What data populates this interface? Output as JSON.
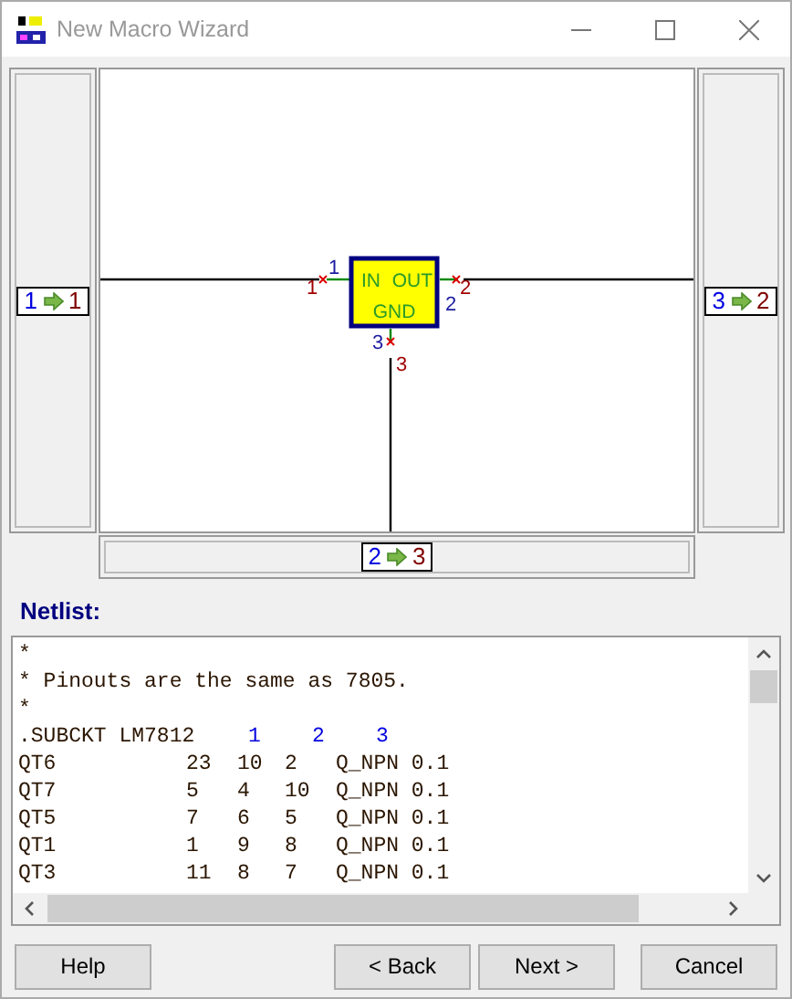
{
  "window": {
    "title": "New Macro Wizard"
  },
  "diagram": {
    "component": {
      "labels": [
        "IN",
        "OUT",
        "GND"
      ]
    },
    "pins": [
      {
        "text": "1",
        "kind": "innumber"
      },
      {
        "text": "1",
        "kind": "innet"
      },
      {
        "text": "2",
        "kind": "outnet"
      },
      {
        "text": "2",
        "kind": "outnumber"
      },
      {
        "text": "3",
        "kind": "gndnumber"
      },
      {
        "text": "3",
        "kind": "gndnet"
      }
    ],
    "ports": [
      {
        "pin": "1",
        "node": "1"
      },
      {
        "pin": "3",
        "node": "2"
      },
      {
        "pin": "2",
        "node": "3"
      }
    ]
  },
  "netlist": {
    "label": "Netlist:",
    "lines": [
      {
        "kind": "text",
        "text": "*"
      },
      {
        "kind": "text",
        "text": "* Pinouts are the same as 7805."
      },
      {
        "kind": "text",
        "text": "*"
      },
      {
        "kind": "subckt",
        "text": ".SUBCKT LM7812",
        "nodes": [
          "1",
          "2",
          "3"
        ]
      },
      {
        "kind": "element",
        "cells": [
          "QT6",
          "23",
          "10",
          "2",
          "Q_NPN 0.1"
        ]
      },
      {
        "kind": "element",
        "cells": [
          "QT7",
          "5",
          "4",
          "10",
          "Q_NPN 0.1"
        ]
      },
      {
        "kind": "element",
        "cells": [
          "QT5",
          "7",
          "6",
          "5",
          "Q_NPN 0.1"
        ]
      },
      {
        "kind": "element",
        "cells": [
          "QT1",
          "1",
          "9",
          "8",
          "Q_NPN 0.1"
        ]
      },
      {
        "kind": "element",
        "cells": [
          "QT3",
          "11",
          "8",
          "7",
          "Q_NPN 0.1"
        ]
      }
    ]
  },
  "buttons": [
    {
      "label": "Help",
      "kind": "help"
    },
    {
      "label": "< Back",
      "kind": "nav"
    },
    {
      "label": "Next >",
      "kind": "nav"
    },
    {
      "label": "Cancel",
      "kind": "cancel"
    }
  ]
}
